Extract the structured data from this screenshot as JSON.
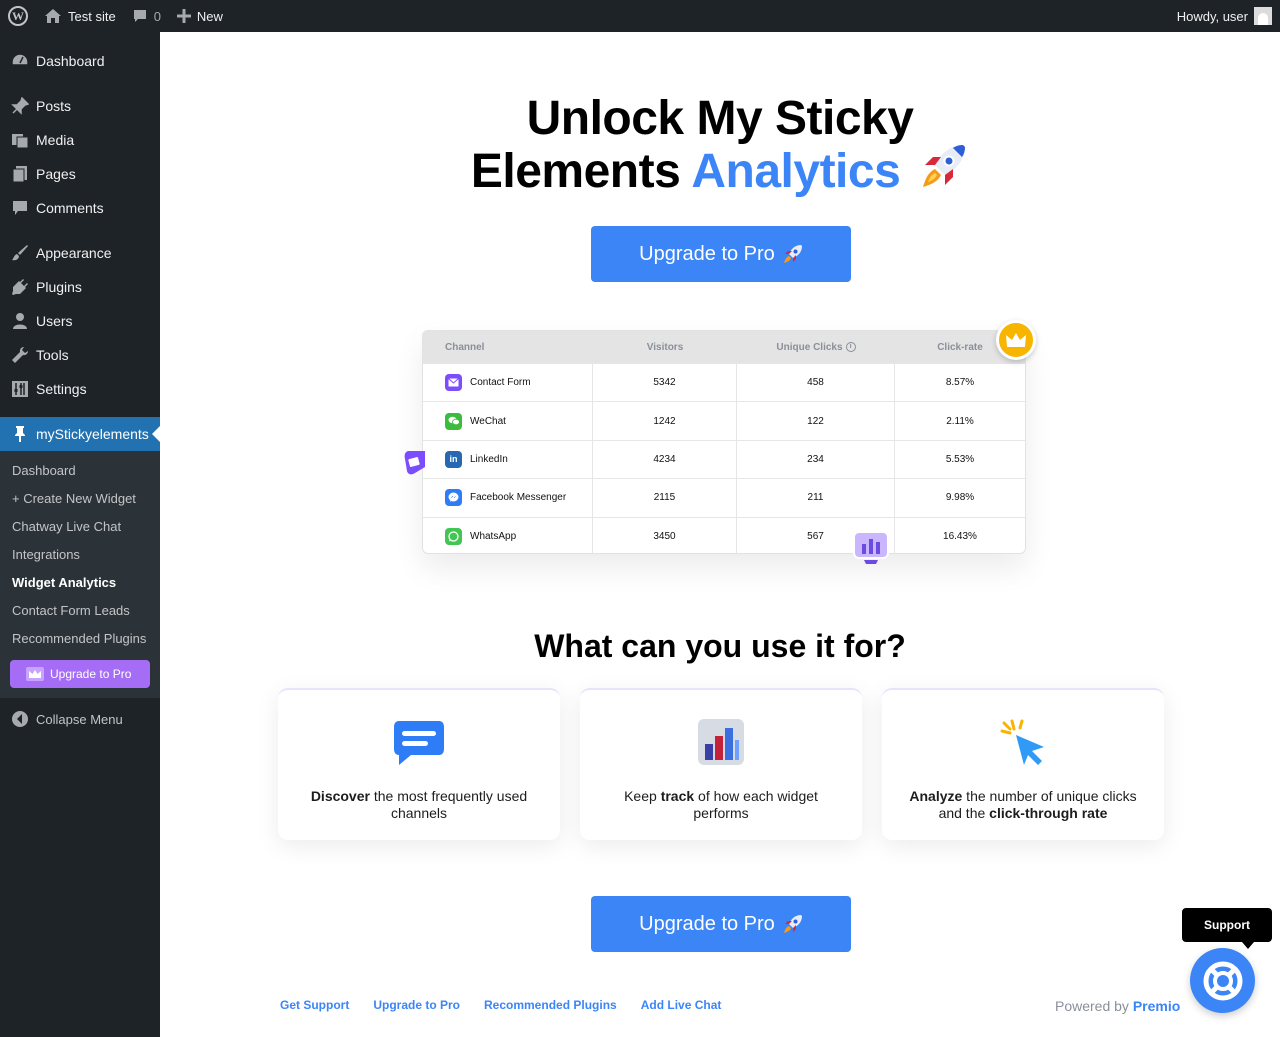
{
  "adminbar": {
    "site_name": "Test site",
    "comments_count": "0",
    "new_label": "New",
    "howdy": "Howdy, user",
    "icons": [
      "wordpress-logo-icon",
      "home-icon",
      "comment-icon",
      "plus-icon",
      "avatar"
    ]
  },
  "sidebar": {
    "items": [
      {
        "label": "Dashboard",
        "icon": "dashboard-icon"
      },
      {
        "label": "Posts",
        "icon": "pin-icon"
      },
      {
        "label": "Media",
        "icon": "media-icon"
      },
      {
        "label": "Pages",
        "icon": "pages-icon"
      },
      {
        "label": "Comments",
        "icon": "comment-icon"
      },
      {
        "label": "Appearance",
        "icon": "brush-icon"
      },
      {
        "label": "Plugins",
        "icon": "plug-icon"
      },
      {
        "label": "Users",
        "icon": "user-icon"
      },
      {
        "label": "Tools",
        "icon": "wrench-icon"
      },
      {
        "label": "Settings",
        "icon": "settings-icon"
      },
      {
        "label": "myStickyelements",
        "icon": "thumbtack-icon"
      }
    ],
    "submenu": [
      "Dashboard",
      "+ Create New Widget",
      "Chatway Live Chat",
      "Integrations",
      "Widget Analytics",
      "Contact Form Leads",
      "Recommended Plugins"
    ],
    "upgrade_label": "Upgrade to Pro",
    "collapse_label": "Collapse Menu"
  },
  "hero": {
    "title_line1": "Unlock My Sticky",
    "title_line2_plain": "Elements",
    "title_line2_accent": "Analytics",
    "accent_color": "#3c85f7"
  },
  "buttons": {
    "upgrade_top": "Upgrade to Pro",
    "upgrade_bottom": "Upgrade to Pro"
  },
  "table": {
    "headers": [
      "Channel",
      "Visitors",
      "Unique Clicks",
      "Click-rate"
    ],
    "rows": [
      {
        "channel": "Contact Form",
        "visitors": "5342",
        "unique": "458",
        "rate": "8.57%",
        "icon": "envelope-icon",
        "color": "#7c4dff"
      },
      {
        "channel": "WeChat",
        "visitors": "1242",
        "unique": "122",
        "rate": "2.11%",
        "icon": "wechat-icon",
        "color": "#3dbb3c"
      },
      {
        "channel": "LinkedIn",
        "visitors": "4234",
        "unique": "234",
        "rate": "5.53%",
        "icon": "linkedin-icon",
        "color": "#2867b2"
      },
      {
        "channel": "Facebook Messenger",
        "visitors": "2115",
        "unique": "211",
        "rate": "9.98%",
        "icon": "messenger-icon",
        "color": "#2f7df6"
      },
      {
        "channel": "WhatsApp",
        "visitors": "3450",
        "unique": "567",
        "rate": "16.43%",
        "icon": "whatsapp-icon",
        "color": "#43c553"
      }
    ]
  },
  "features": {
    "title": "What can you use it for?",
    "cards": [
      {
        "icon": "chat-bubble-icon",
        "bold1": "Discover",
        "text1": " the most frequently used channels",
        "bold2": "",
        "text2": ""
      },
      {
        "icon": "bar-chart-icon",
        "bold1": "",
        "text1": "Keep ",
        "bold2": "track",
        "text2": " of how each widget performs"
      },
      {
        "icon": "cursor-click-icon",
        "bold1": "Analyze",
        "text1": " the number of unique clicks and the ",
        "bold2": "click-through rate",
        "text2": ""
      }
    ]
  },
  "footer": {
    "links": [
      "Get Support",
      "Upgrade to Pro",
      "Recommended Plugins",
      "Add Live Chat"
    ],
    "powered_by": "Powered by",
    "brand": "Premio"
  },
  "support": {
    "label": "Support"
  }
}
